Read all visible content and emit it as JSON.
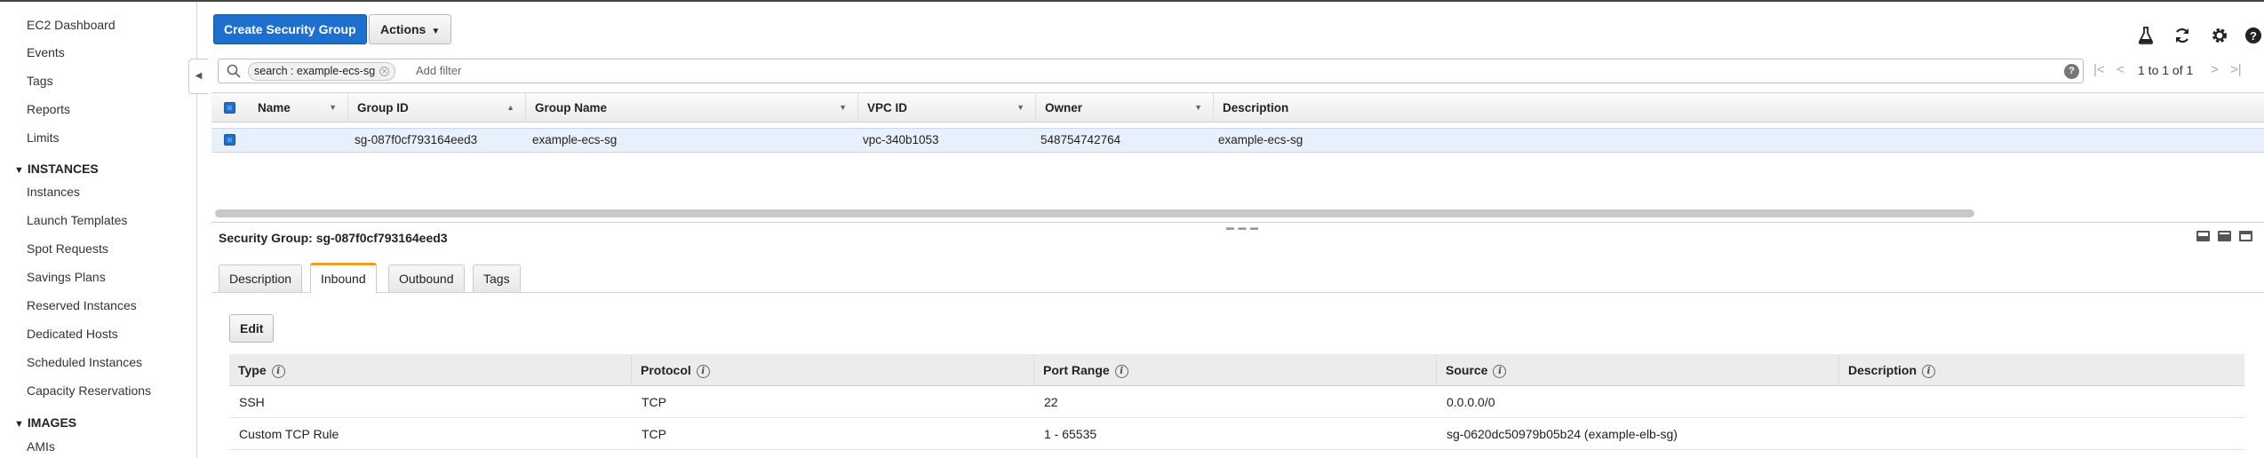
{
  "sidebar": {
    "items": [
      {
        "label": "EC2 Dashboard"
      },
      {
        "label": "Events"
      },
      {
        "label": "Tags"
      },
      {
        "label": "Reports"
      },
      {
        "label": "Limits"
      }
    ],
    "sections": [
      {
        "title": "INSTANCES",
        "items": [
          {
            "label": "Instances"
          },
          {
            "label": "Launch Templates"
          },
          {
            "label": "Spot Requests"
          },
          {
            "label": "Savings Plans"
          },
          {
            "label": "Reserved Instances"
          },
          {
            "label": "Dedicated Hosts"
          },
          {
            "label": "Scheduled Instances"
          },
          {
            "label": "Capacity Reservations"
          }
        ]
      },
      {
        "title": "IMAGES",
        "items": [
          {
            "label": "AMIs"
          }
        ]
      }
    ]
  },
  "toolbar": {
    "create_label": "Create Security Group",
    "actions_label": "Actions",
    "icons": [
      "flask-icon",
      "refresh-icon",
      "gear-icon",
      "help-icon"
    ]
  },
  "search": {
    "token": "search : example-ecs-sg",
    "placeholder": "Add filter",
    "pagination": "1 to 1 of 1"
  },
  "table": {
    "columns": [
      "Name",
      "Group ID",
      "Group Name",
      "VPC ID",
      "Owner",
      "Description"
    ],
    "rows": [
      {
        "name": "",
        "group_id": "sg-087f0cf793164eed3",
        "group_name": "example-ecs-sg",
        "vpc_id": "vpc-340b1053",
        "owner": "548754742764",
        "description": "example-ecs-sg"
      }
    ]
  },
  "detail": {
    "title_label": "Security Group:",
    "title_value": "sg-087f0cf793164eed3",
    "tabs": [
      "Description",
      "Inbound",
      "Outbound",
      "Tags"
    ],
    "active_tab": "Inbound",
    "edit_label": "Edit",
    "rules": {
      "columns": [
        "Type",
        "Protocol",
        "Port Range",
        "Source",
        "Description"
      ],
      "rows": [
        {
          "type": "SSH",
          "protocol": "TCP",
          "port_range": "22",
          "source": "0.0.0.0/0",
          "description": ""
        },
        {
          "type": "Custom TCP Rule",
          "protocol": "TCP",
          "port_range": "1 - 65535",
          "source": "sg-0620dc50979b05b24 (example-elb-sg)",
          "description": ""
        }
      ]
    }
  },
  "colors": {
    "primary": "#1f6fcf",
    "active_tab_accent": "#f0a01e",
    "selected_row": "#e8f1fb"
  }
}
